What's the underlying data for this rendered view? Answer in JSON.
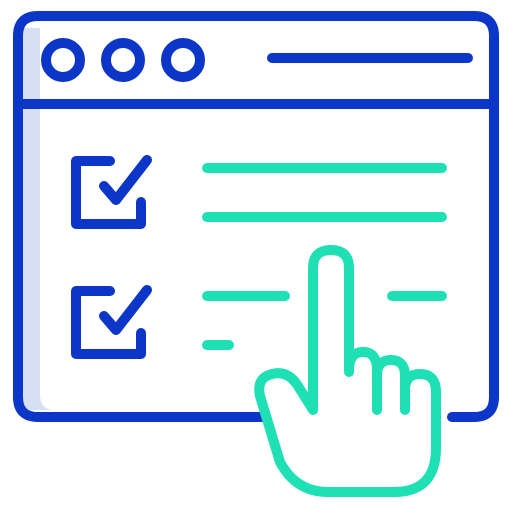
{
  "icon": {
    "name": "online-checklist-icon",
    "colors": {
      "frame": "#0b36c8",
      "accent": "#1fe0b4",
      "shadow": "#d5e0f5",
      "background": "#ffffff"
    },
    "window": {
      "control_dots": [
        "window-dot-icon",
        "window-dot-icon",
        "window-dot-icon"
      ],
      "title_bar_line": "title-bar-line"
    },
    "checklist": {
      "items": [
        {
          "checked": true,
          "icon": "checkbox-checked-icon",
          "text_lines": 2
        },
        {
          "checked": true,
          "icon": "checkbox-checked-icon",
          "text_lines": 2
        }
      ]
    },
    "pointer": "hand-pointer-icon"
  }
}
